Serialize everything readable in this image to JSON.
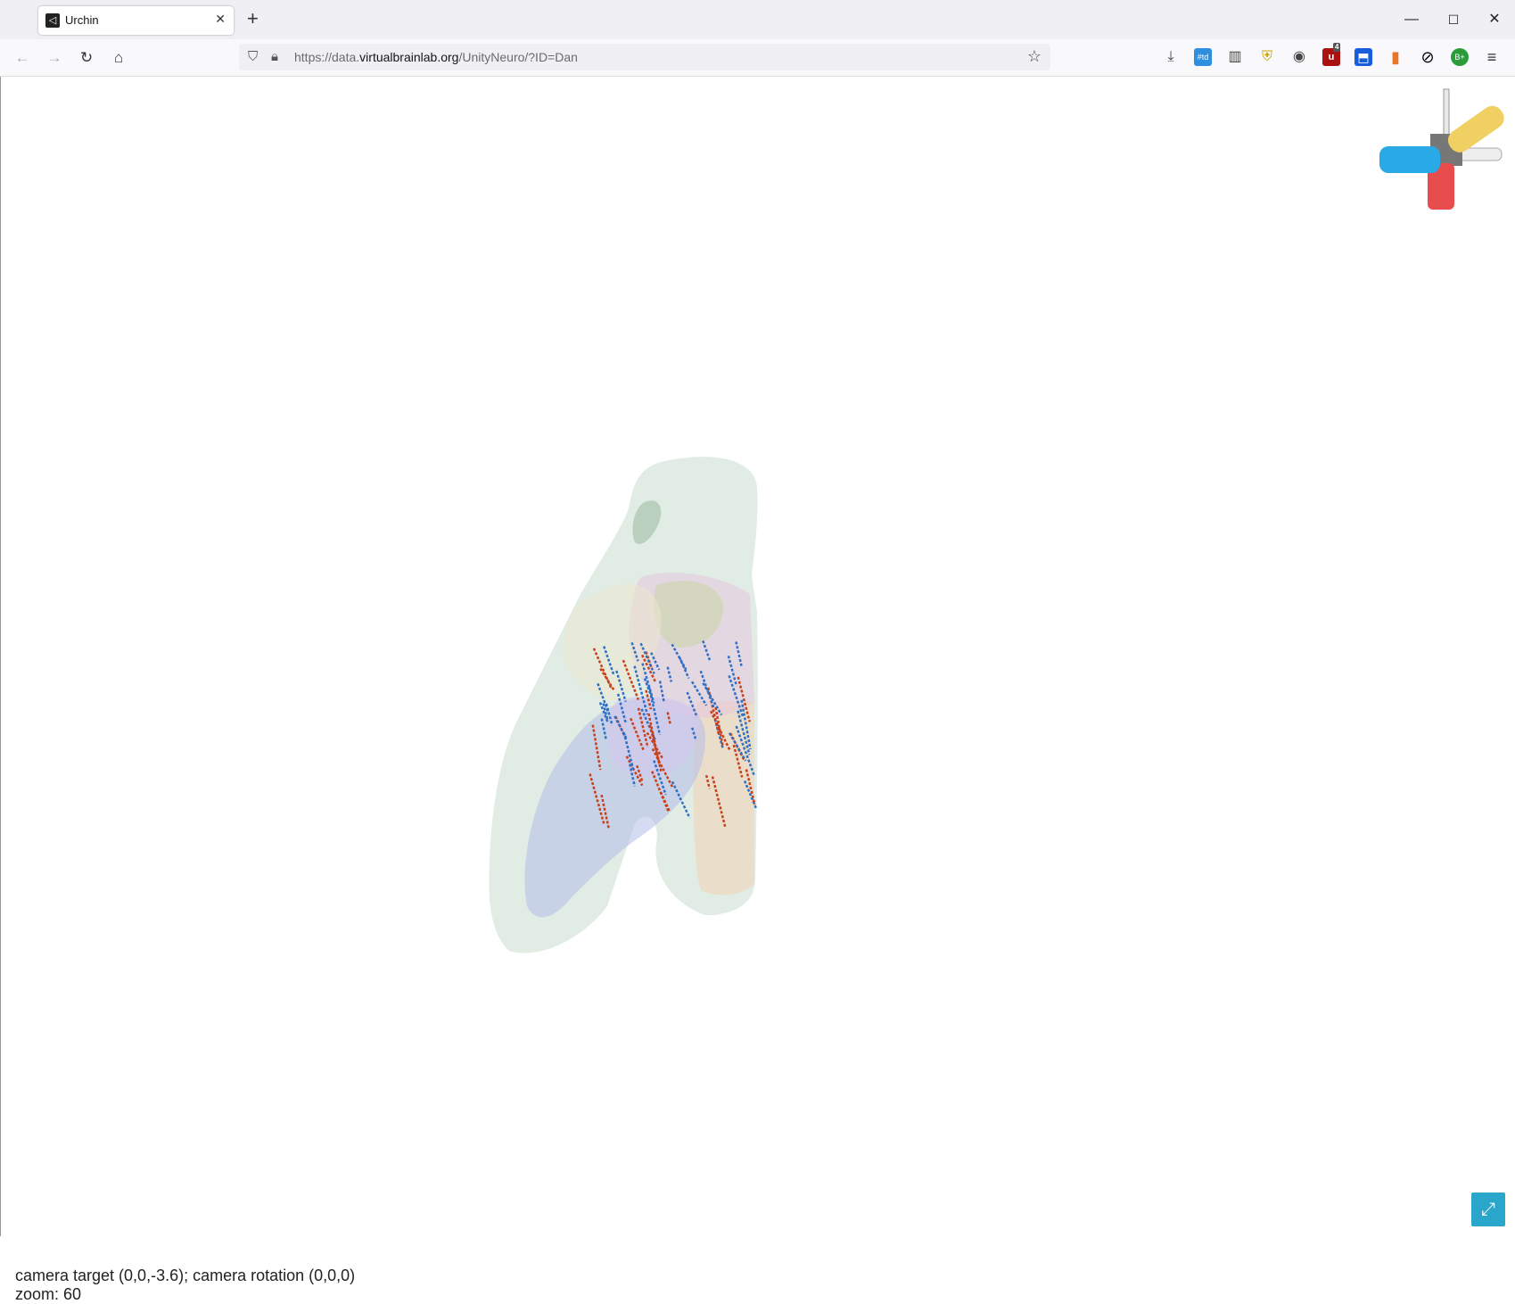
{
  "browser": {
    "tab_title": "Urchin",
    "tab_close": "✕",
    "new_tab": "+",
    "url_prefix": "https://data.",
    "url_domain": "virtualbrainlab.org",
    "url_path": "/UnityNeuro/?ID=Dan",
    "window_controls": [
      "—",
      "☐",
      "✕"
    ]
  },
  "extensions": [
    {
      "icon": "downloads-icon",
      "label": "⤓"
    },
    {
      "icon": "td-icon",
      "label": "#td"
    },
    {
      "icon": "columns-icon",
      "label": "▥"
    },
    {
      "icon": "shield-badge-icon",
      "label": "⛨"
    },
    {
      "icon": "eye-icon",
      "label": "◉"
    },
    {
      "icon": "ublock-icon",
      "label": "u",
      "badge": "4"
    },
    {
      "icon": "bitwarden-icon",
      "label": "⬒"
    },
    {
      "icon": "trash-icon",
      "label": "▮"
    },
    {
      "icon": "block-icon",
      "label": "⊘"
    },
    {
      "icon": "bplus-icon",
      "label": "B+"
    },
    {
      "icon": "menu-icon",
      "label": "≡"
    }
  ],
  "viewer": {
    "status_line1": "camera target (0,0,-3.6); camera rotation (0,0,0)",
    "status_line2": "zoom: 60",
    "fullscreen_label": "⤢"
  },
  "colors": {
    "probe_red": "#c8401a",
    "probe_blue": "#2f6fc4",
    "axis_blue": "#29a9e6",
    "axis_yellow": "#f0d062",
    "axis_red": "#e84c4c",
    "fullscreen_bg": "#2ba6cb"
  }
}
